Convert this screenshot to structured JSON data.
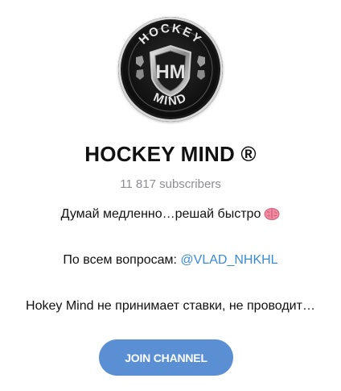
{
  "channel": {
    "title": "HOCKEY MIND ®",
    "subscribers": "11 817 subscribers",
    "avatar": {
      "logo_top_text": "HOCKEY",
      "logo_bottom_text": "MIND",
      "logo_monogram": "HM"
    }
  },
  "description": {
    "line1": "Думай медленно…решай быстро",
    "line1_icon": "brain-icon",
    "line2_prefix": "По всем вопросам: ",
    "line2_link": "@VLAD_NHKHL",
    "line3": "Hokey Mind не принимает ставки, не проводит…"
  },
  "actions": {
    "join_label": "JOIN CHANNEL"
  },
  "colors": {
    "accent": "#5b8fd3",
    "link": "#3a8bd6",
    "muted": "#8e8e93",
    "text": "#111111"
  }
}
